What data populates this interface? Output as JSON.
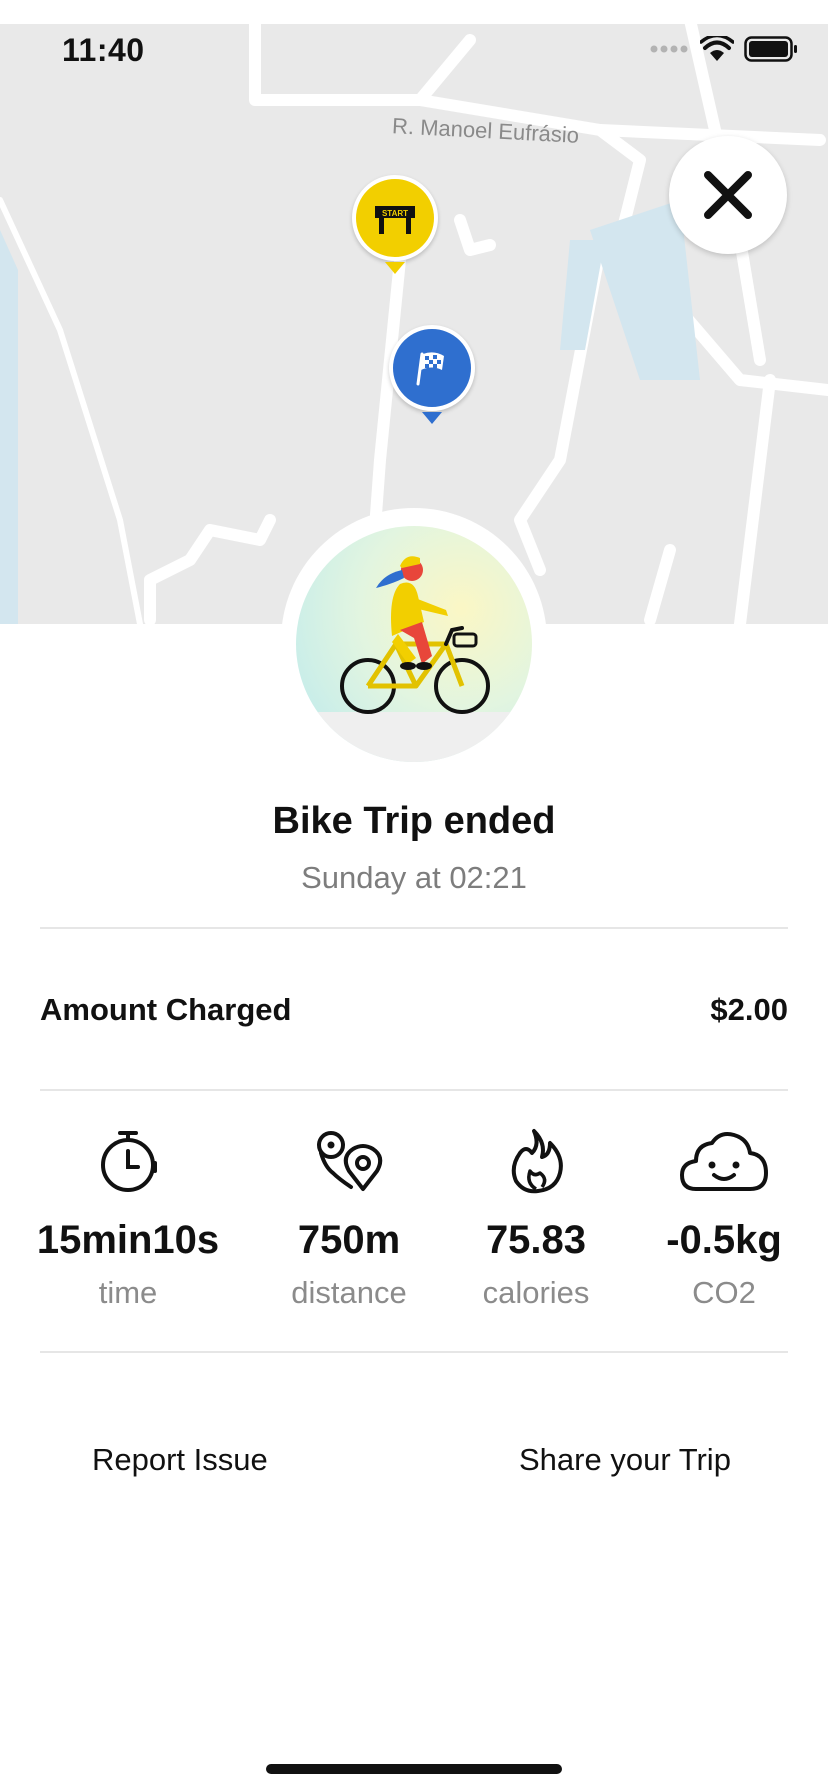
{
  "status_bar": {
    "time": "11:40",
    "icons": [
      "signal-icon",
      "wifi-icon",
      "battery-icon"
    ]
  },
  "map": {
    "street_label": "R. Manoel Eufrásio",
    "start_pin": {
      "icon": "start-banner-icon",
      "text": "START",
      "color": "#f2cf00"
    },
    "finish_pin": {
      "icon": "checkered-flag-icon",
      "color": "#2f6fcf"
    },
    "close_icon": "close-icon"
  },
  "trip": {
    "illustration": "bike-rider-illustration",
    "title": "Bike Trip ended",
    "subtitle": "Sunday at 02:21"
  },
  "amount": {
    "label": "Amount Charged",
    "value": "$2.00"
  },
  "stats": [
    {
      "icon": "stopwatch-icon",
      "value": "15min10s",
      "label": "time"
    },
    {
      "icon": "location-pin-icon",
      "value": "750m",
      "label": "distance"
    },
    {
      "icon": "flame-icon",
      "value": "75.83",
      "label": "calories"
    },
    {
      "icon": "smiling-cloud-icon",
      "value": "-0.5kg",
      "label": "CO2"
    }
  ],
  "actions": {
    "report_issue": "Report Issue",
    "share_trip": "Share your Trip"
  },
  "colors": {
    "start_pin": "#f2cf00",
    "finish_pin": "#2f6fcf",
    "text_primary": "#111111",
    "text_secondary": "#8b8b8b"
  }
}
